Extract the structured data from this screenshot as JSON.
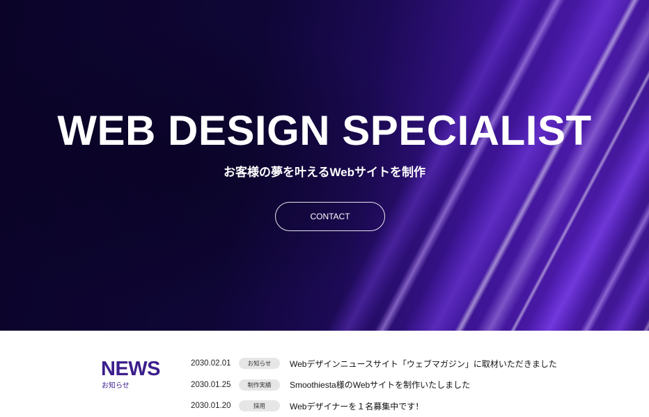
{
  "hero": {
    "title": "WEB DESIGN SPECIALIST",
    "subtitle": "お客様の夢を叶えるWebサイトを制作",
    "contact_label": "CONTACT"
  },
  "news": {
    "heading": "NEWS",
    "subheading": "お知らせ",
    "items": [
      {
        "date": "2030.02.01",
        "tag": "お知らせ",
        "title": "Webデザインニュースサイト「ウェブマガジン」に取材いただきました"
      },
      {
        "date": "2030.01.25",
        "tag": "制作実績",
        "title": "Smoothiesta様のWebサイトを制作いたしました"
      },
      {
        "date": "2030.01.20",
        "tag": "採用",
        "title": "Webデザイナーを１名募集中です！"
      }
    ]
  },
  "colors": {
    "hero_dark": "#0f0636",
    "hero_purple": "#4b1aa8",
    "news_accent": "#3c1e8c",
    "tag_bg": "#e6e6e6"
  }
}
